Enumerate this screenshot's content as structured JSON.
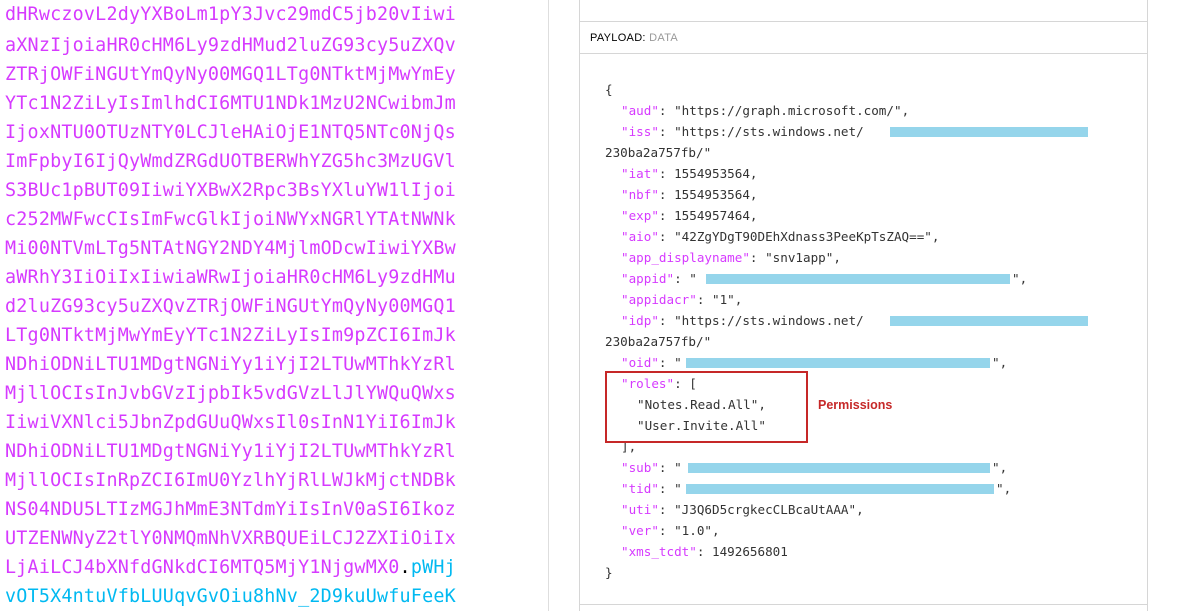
{
  "encoded": {
    "lines": [
      "dHRwczovL2dyYXBoLm1pY3Jvc29mdC5jb20vIiwi",
      "aXNzIjoiaHR0cHM6Ly9zdHMud2luZG93cy5uZXQv",
      "ZTRjOWFiNGUtYmQyNy00MGQ1LTg0NTktMjMwYmEy",
      "YTc1N2ZiLyIsImlhdCI6MTU1NDk1MzU2NCwibmJm",
      "IjoxNTU0OTUzNTY0LCJleHAiOjE1NTQ5NTc0NjQs",
      "ImFpbyI6IjQyWmdZRGdUOTBERWhYZG5hc3MzUGVl",
      "S3BUc1pBUT09IiwiYXBwX2Rpc3BsYXluYW1lIjoi",
      "c252MWFwcCIsImFwcGlkIjoiNWYxNGRlYTAtNWNk",
      "Mi00NTVmLTg5NTAtNGY2NDY4MjlmODcwIiwiYXBw",
      "aWRhY3IiOiIxIiwiaWRwIjoiaHR0cHM6Ly9zdHMu",
      "d2luZG93cy5uZXQvZTRjOWFiNGUtYmQyNy00MGQ1",
      "LTg0NTktMjMwYmEyYTc1N2ZiLyIsIm9pZCI6ImJk",
      "NDhiODNiLTU1MDgtNGNiYy1iYjI2LTUwMThkYzRl",
      "MjllOCIsInJvbGVzIjpbIk5vdGVzLlJlYWQuQWxs",
      "IiwiVXNlci5JbnZpdGUuQWxsIl0sInN1YiI6ImJk",
      "NDhiODNiLTU1MDgtNGNiYy1iYjI2LTUwMThkYzRl",
      "MjllOCIsInRpZCI6ImU0YzlhYjRlLWJkMjctNDBk",
      "NS04NDU5LTIzMGJhMmE3NTdmYiIsInV0aSI6Ikoz",
      "UTZENWNyZ2tlY0NMQmNhVXRBQUEiLCJ2ZXIiOiIx",
      "LjAiLCJ4bXNfdGNkdCI6MTQ5MjY1NjgwMX0"
    ],
    "dot": ".",
    "sig_start": "pWHj",
    "last_line": "vOT5X4ntuVfbLUUqvGvOiu8hNv_2D9kuUwfuFeeK"
  },
  "payload": {
    "header_key": "PAYLOAD:",
    "header_val": "DATA",
    "open_brace": "{",
    "close_brace": "}",
    "aud_key": "\"aud\"",
    "aud_val": "\"https://graph.microsoft.com/\"",
    "iss_key": "\"iss\"",
    "iss_val_start": "\"https://sts.windows.net/",
    "iss_val_end": "230ba2a757fb/\"",
    "iat_key": "\"iat\"",
    "iat_val": "1554953564",
    "nbf_key": "\"nbf\"",
    "nbf_val": "1554953564",
    "exp_key": "\"exp\"",
    "exp_val": "1554957464",
    "aio_key": "\"aio\"",
    "aio_val": "\"42ZgYDgT90DEhXdnass3PeeKpTsZAQ==\"",
    "app_displayname_key": "\"app_displayname\"",
    "app_displayname_val": "\"snv1app\"",
    "appid_key": "\"appid\"",
    "appid_val_start": "\"",
    "appidacr_key": "\"appidacr\"",
    "appidacr_val": "\"1\"",
    "idp_key": "\"idp\"",
    "idp_val_start": "\"https://sts.windows.net/",
    "idp_val_end": "230ba2a757fb/\"",
    "oid_key": "\"oid\"",
    "oid_val_start": "\"",
    "roles_key": "\"roles\"",
    "roles_open": "[",
    "roles": [
      "\"Notes.Read.All\"",
      "\"User.Invite.All\""
    ],
    "roles_close": "],",
    "sub_key": "\"sub\"",
    "sub_val_start": "\"",
    "tid_key": "\"tid\"",
    "tid_val_start": "\"",
    "uti_key": "\"uti\"",
    "uti_val": "\"J3Q6D5crgkecCLBcaUtAAA\"",
    "ver_key": "\"ver\"",
    "ver_val": "\"1.0\"",
    "xms_tcdt_key": "\"xms_tcdt\"",
    "xms_tcdt_val": "1492656801"
  },
  "annotation": {
    "label": "Permissions",
    "color": "#c62828"
  },
  "colors": {
    "property": "#d63aff",
    "signature": "#00b9f1",
    "redaction": "#8fd3ea"
  }
}
